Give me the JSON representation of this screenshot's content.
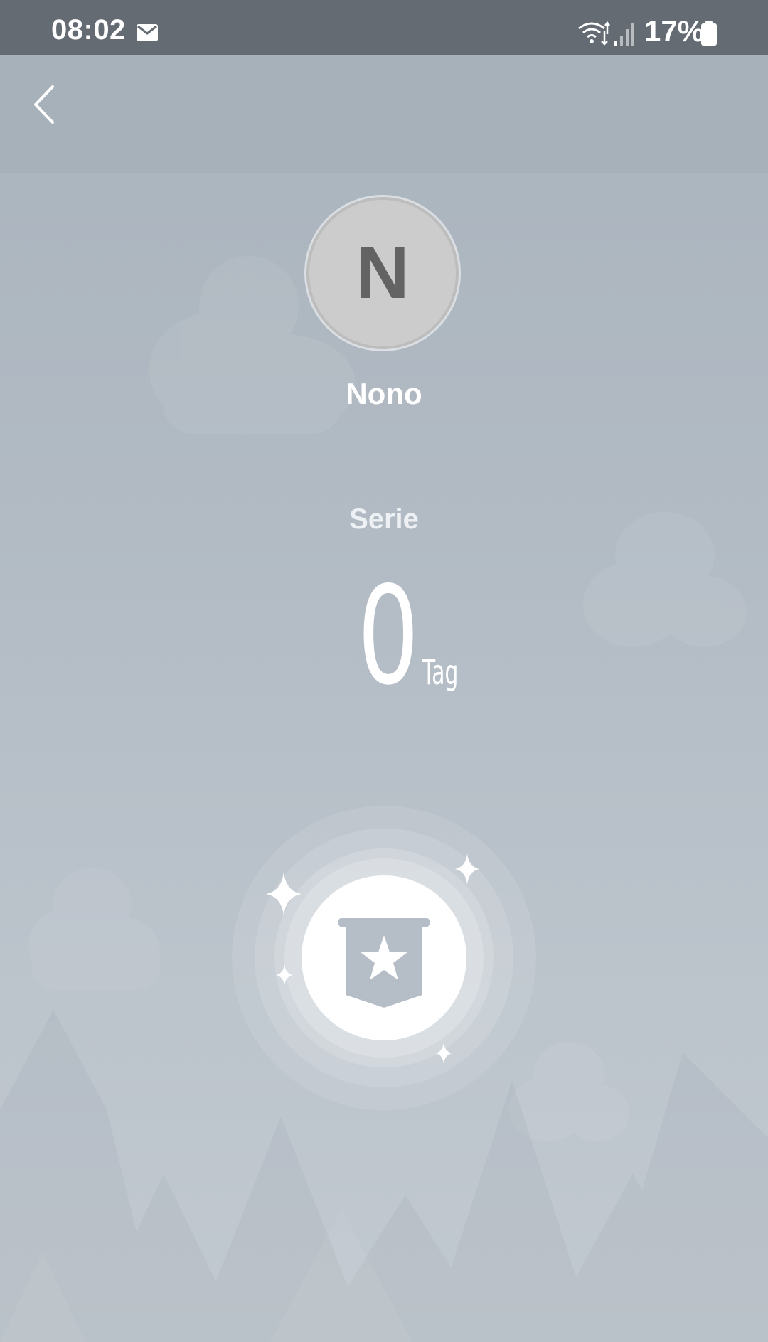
{
  "status_bar": {
    "time": "08:02",
    "battery_percent": "17%",
    "icons": [
      "mail-icon",
      "wifi-icon",
      "signal-icon",
      "battery-icon"
    ]
  },
  "profile": {
    "avatar_initial": "N",
    "name": "Nono"
  },
  "streak": {
    "label": "Serie",
    "value": "0",
    "unit": "Tag"
  },
  "badge": {
    "icon": "banner-star-icon"
  },
  "colors": {
    "status_bar_bg": "#646b72",
    "background_top": "#a9b3bc",
    "background_bottom": "#c2c9d0",
    "avatar_bg": "#cccccc",
    "avatar_letter": "#636363",
    "text": "#ffffff"
  }
}
